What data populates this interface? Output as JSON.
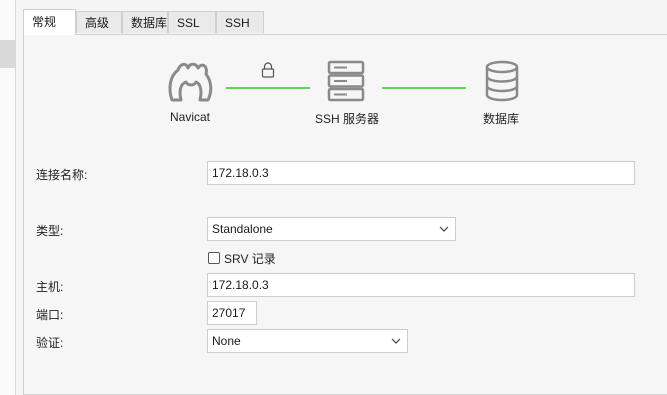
{
  "tabs": [
    {
      "label": "常规",
      "active": true
    },
    {
      "label": "高级",
      "active": false
    },
    {
      "label": "数据库",
      "active": false
    },
    {
      "label": "SSL",
      "active": false
    },
    {
      "label": "SSH",
      "active": false
    }
  ],
  "diagram": {
    "client_label": "Navicat",
    "ssh_label": "SSH 服务器",
    "db_label": "数据库",
    "line_color": "#5ed25a",
    "icons": [
      "navicat-logo-icon",
      "lock-icon",
      "server-icon",
      "database-icon"
    ]
  },
  "form": {
    "conn_name_label": "连接名称:",
    "conn_name_value": "172.18.0.3",
    "type_label": "类型:",
    "type_value": "Standalone",
    "srv_label": "SRV 记录",
    "srv_checked": false,
    "host_label": "主机:",
    "host_value": "172.18.0.3",
    "port_label": "端口:",
    "port_value": "27017",
    "auth_label": "验证:",
    "auth_value": "None"
  }
}
